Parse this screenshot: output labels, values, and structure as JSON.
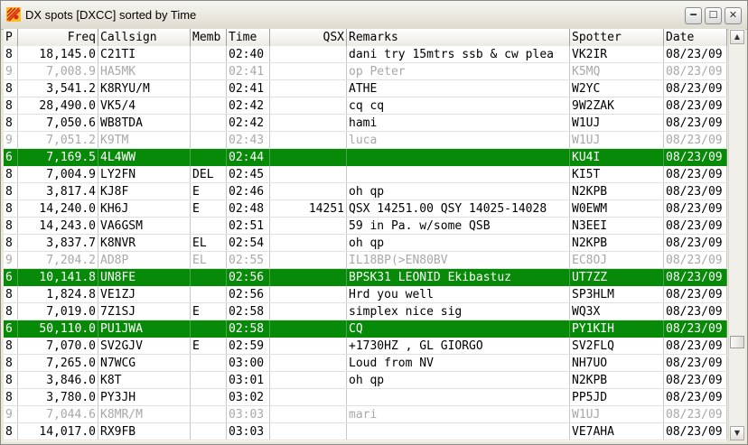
{
  "window": {
    "title": "DX spots [DXCC] sorted by Time",
    "minimize_icon": "minimize-icon",
    "maximize_icon": "maximize-icon",
    "close_icon": "close-icon"
  },
  "columns": [
    "P",
    "Freq",
    "Callsign",
    "Memb",
    "Time",
    "QSX",
    "Remarks",
    "Spotter",
    "Date"
  ],
  "colors": {
    "highlight": "#078a07",
    "dim_text": "#a8a8a8"
  },
  "rows": [
    {
      "style": "normal",
      "p": "8",
      "freq": "18,145.0",
      "call": "C21TI",
      "memb": "",
      "time": "02:40",
      "qsx": "",
      "remarks": "dani try 15mtrs ssb & cw plea",
      "spotter": "VK2IR",
      "date": "08/23/09"
    },
    {
      "style": "dim",
      "p": "9",
      "freq": "7,008.9",
      "call": "HA5MK",
      "memb": "",
      "time": "02:41",
      "qsx": "",
      "remarks": "op Peter",
      "spotter": "K5MQ",
      "date": "08/23/09"
    },
    {
      "style": "normal",
      "p": "8",
      "freq": "3,541.2",
      "call": "K8RYU/M",
      "memb": "",
      "time": "02:41",
      "qsx": "",
      "remarks": "ATHE",
      "spotter": "W2YC",
      "date": "08/23/09"
    },
    {
      "style": "normal",
      "p": "8",
      "freq": "28,490.0",
      "call": "VK5/4",
      "memb": "",
      "time": "02:42",
      "qsx": "",
      "remarks": "cq cq",
      "spotter": "9W2ZAK",
      "date": "08/23/09"
    },
    {
      "style": "normal",
      "p": "8",
      "freq": "7,050.6",
      "call": "WB8TDA",
      "memb": "",
      "time": "02:42",
      "qsx": "",
      "remarks": "hami",
      "spotter": "W1UJ",
      "date": "08/23/09"
    },
    {
      "style": "dim",
      "p": "9",
      "freq": "7,051.2",
      "call": "K9TM",
      "memb": "",
      "time": "02:43",
      "qsx": "",
      "remarks": "luca",
      "spotter": "W1UJ",
      "date": "08/23/09"
    },
    {
      "style": "hl",
      "p": "6",
      "freq": "7,169.5",
      "call": "4L4WW",
      "memb": "",
      "time": "02:44",
      "qsx": "",
      "remarks": "",
      "spotter": "KU4I",
      "date": "08/23/09"
    },
    {
      "style": "normal",
      "p": "8",
      "freq": "7,004.9",
      "call": "LY2FN",
      "memb": "DEL",
      "time": "02:45",
      "qsx": "",
      "remarks": "",
      "spotter": "KI5T",
      "date": "08/23/09"
    },
    {
      "style": "normal",
      "p": "8",
      "freq": "3,817.4",
      "call": "KJ8F",
      "memb": "E",
      "time": "02:46",
      "qsx": "",
      "remarks": "oh qp",
      "spotter": "N2KPB",
      "date": "08/23/09"
    },
    {
      "style": "normal",
      "p": "8",
      "freq": "14,240.0",
      "call": "KH6J",
      "memb": "E",
      "time": "02:48",
      "qsx": "14251",
      "remarks": "QSX 14251.00 QSY 14025-14028",
      "spotter": "W0EWM",
      "date": "08/23/09"
    },
    {
      "style": "normal",
      "p": "8",
      "freq": "14,243.0",
      "call": "VA6GSM",
      "memb": "",
      "time": "02:51",
      "qsx": "",
      "remarks": "59 in Pa. w/some QSB",
      "spotter": "N3EEI",
      "date": "08/23/09"
    },
    {
      "style": "normal",
      "p": "8",
      "freq": "3,837.7",
      "call": "K8NVR",
      "memb": "EL",
      "time": "02:54",
      "qsx": "",
      "remarks": "oh qp",
      "spotter": "N2KPB",
      "date": "08/23/09"
    },
    {
      "style": "dim",
      "p": "9",
      "freq": "7,204.2",
      "call": "AD8P",
      "memb": "EL",
      "time": "02:55",
      "qsx": "",
      "remarks": "IL18BP(>EN80BV",
      "spotter": "EC8OJ",
      "date": "08/23/09"
    },
    {
      "style": "hl",
      "p": "6",
      "freq": "10,141.8",
      "call": "UN8FE",
      "memb": "",
      "time": "02:56",
      "qsx": "",
      "remarks": "BPSK31 LEONID Ekibastuz",
      "spotter": "UT7ZZ",
      "date": "08/23/09"
    },
    {
      "style": "normal",
      "p": "8",
      "freq": "1,824.8",
      "call": "VE1ZJ",
      "memb": "",
      "time": "02:56",
      "qsx": "",
      "remarks": "Hrd you well",
      "spotter": "SP3HLM",
      "date": "08/23/09"
    },
    {
      "style": "normal",
      "p": "8",
      "freq": "7,019.0",
      "call": "7Z1SJ",
      "memb": "E",
      "time": "02:58",
      "qsx": "",
      "remarks": "simplex nice sig",
      "spotter": "WQ3X",
      "date": "08/23/09"
    },
    {
      "style": "hl",
      "p": "6",
      "freq": "50,110.0",
      "call": "PU1JWA",
      "memb": "",
      "time": "02:58",
      "qsx": "",
      "remarks": "CQ",
      "spotter": "PY1KIH",
      "date": "08/23/09"
    },
    {
      "style": "normal",
      "p": "8",
      "freq": "7,070.0",
      "call": "SV2GJV",
      "memb": "E",
      "time": "02:59",
      "qsx": "",
      "remarks": "+1730HZ , GL GIORGO",
      "spotter": "SV2FLQ",
      "date": "08/23/09"
    },
    {
      "style": "normal",
      "p": "8",
      "freq": "7,265.0",
      "call": "N7WCG",
      "memb": "",
      "time": "03:00",
      "qsx": "",
      "remarks": "Loud from NV",
      "spotter": "NH7UO",
      "date": "08/23/09"
    },
    {
      "style": "normal",
      "p": "8",
      "freq": "3,846.0",
      "call": "K8T",
      "memb": "",
      "time": "03:01",
      "qsx": "",
      "remarks": "oh qp",
      "spotter": "N2KPB",
      "date": "08/23/09"
    },
    {
      "style": "normal",
      "p": "8",
      "freq": "3,780.0",
      "call": "PY3JH",
      "memb": "",
      "time": "03:02",
      "qsx": "",
      "remarks": "",
      "spotter": "PP5JD",
      "date": "08/23/09"
    },
    {
      "style": "dim",
      "p": "9",
      "freq": "7,044.6",
      "call": "K8MR/M",
      "memb": "",
      "time": "03:03",
      "qsx": "",
      "remarks": "mari",
      "spotter": "W1UJ",
      "date": "08/23/09"
    },
    {
      "style": "normal",
      "p": "8",
      "freq": "14,017.0",
      "call": "RX9FB",
      "memb": "",
      "time": "03:03",
      "qsx": "",
      "remarks": "",
      "spotter": "VE7AHA",
      "date": "08/23/09"
    }
  ]
}
